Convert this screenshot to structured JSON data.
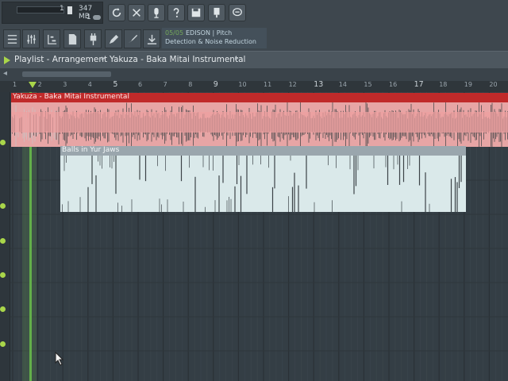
{
  "toolbar": {
    "memory_value": "347 MB",
    "counter_top": "1",
    "counter_bottom": "1",
    "buttons": [
      {
        "name": "loop-record-button",
        "icon": "refresh-icon"
      },
      {
        "name": "metronome-button",
        "icon": "metronome-icon"
      },
      {
        "name": "mic-record-button",
        "icon": "microphone-icon"
      },
      {
        "name": "help-button",
        "icon": "question-icon"
      },
      {
        "name": "save-button",
        "icon": "disk-icon"
      },
      {
        "name": "plugin-button",
        "icon": "plug-icon"
      },
      {
        "name": "chat-button",
        "icon": "speech-bubble-icon"
      }
    ],
    "tools": [
      {
        "name": "channel-rack-button",
        "icon": "grid-icon"
      },
      {
        "name": "mixer-button",
        "icon": "sliders-icon"
      },
      {
        "name": "piano-roll-button",
        "icon": "pianoroll-icon"
      },
      {
        "name": "browser-button",
        "icon": "file-icon"
      },
      {
        "name": "plugin-picker-button",
        "icon": "plug-icon"
      },
      {
        "name": "playlist-tool-button",
        "icon": "pencil-icon"
      },
      {
        "name": "edit-tool-button",
        "icon": "brush-icon"
      },
      {
        "name": "download-button",
        "icon": "download-icon"
      }
    ]
  },
  "hint": {
    "number": "05/05",
    "line1": "EDISON | Pitch",
    "line2": "Detection & Noise Reduction"
  },
  "title": {
    "text": "Playlist - Arrangement",
    "clip": "Yakuza - Baka Mitai Instrumental"
  },
  "ruler": {
    "labels": [
      "1",
      "2",
      "3",
      "4",
      "5",
      "6",
      "7",
      "8",
      "9",
      "10",
      "11",
      "12",
      "13",
      "14",
      "15",
      "16",
      "17",
      "18",
      "19",
      "20"
    ],
    "big": [
      "5",
      "9",
      "13",
      "17"
    ]
  },
  "clips": [
    {
      "name": "Yakuza - Baka Mitai Instrumental",
      "color": "#c02a2a",
      "body": "#e7a5a5"
    },
    {
      "name": "Balls in Yur Jaws",
      "color": "#9aa6ad",
      "body": "#dae9ea"
    }
  ],
  "colors": {
    "accent_green": "#63b04a",
    "track_dot": "#a9d64a"
  }
}
